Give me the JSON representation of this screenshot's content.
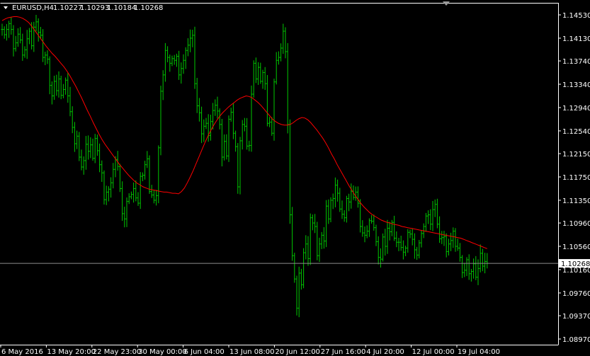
{
  "header": {
    "symbol": "EURUSD,H4",
    "open": "1.10227",
    "high": "1.10293",
    "low": "1.10184",
    "close": "1.10268"
  },
  "colors": {
    "background": "#000000",
    "axis": "#ffffff",
    "bars": "#00c800",
    "moving_average": "#ff0000",
    "price_line": "#8c8c8c",
    "price_tag_bg": "#ffffff",
    "price_tag_text": "#000000"
  },
  "chart_data": {
    "type": "line",
    "chart_style": "ohlc-bars",
    "title": "EURUSD,H4  1.10227 1.10293 1.10184 1.10268",
    "xlabel": "",
    "ylabel": "",
    "ylim": [
      1.0897,
      1.1473
    ],
    "grid": false,
    "y_ticks": [
      "1.14530",
      "1.14130",
      "1.13740",
      "1.13340",
      "1.12940",
      "1.12540",
      "1.12150",
      "1.11750",
      "1.11350",
      "1.10960",
      "1.10560",
      "1.10160",
      "1.09760",
      "1.09370",
      "1.08970"
    ],
    "x_ticks": [
      "6 May 2016",
      "13 May 20:00",
      "22 May 23:00",
      "30 May 00:00",
      "6 Jun 04:00",
      "13 Jun 08:00",
      "20 Jun 12:00",
      "27 Jun 16:00",
      "4 Jul 20:00",
      "12 Jul 00:00",
      "19 Jul 04:00"
    ],
    "current_price": "1.10268",
    "bars_close": [
      1.1428,
      1.1419,
      1.1428,
      1.1438,
      1.1428,
      1.1395,
      1.1405,
      1.142,
      1.141,
      1.1384,
      1.1393,
      1.1412,
      1.1425,
      1.14,
      1.1432,
      1.1441,
      1.1423,
      1.1418,
      1.138,
      1.1384,
      1.1377,
      1.1332,
      1.1314,
      1.1339,
      1.1323,
      1.1343,
      1.1315,
      1.1325,
      1.1341,
      1.1314,
      1.1287,
      1.126,
      1.1232,
      1.1245,
      1.1209,
      1.1192,
      1.1203,
      1.1231,
      1.1219,
      1.123,
      1.1207,
      1.1241,
      1.122,
      1.1196,
      1.1182,
      1.1136,
      1.1149,
      1.1154,
      1.1165,
      1.1188,
      1.1205,
      1.1193,
      1.1155,
      1.1112,
      1.1103,
      1.1133,
      1.1141,
      1.1145,
      1.1155,
      1.1139,
      1.113,
      1.1176,
      1.1178,
      1.1196,
      1.1206,
      1.115,
      1.1144,
      1.1135,
      1.1143,
      1.1225,
      1.1322,
      1.135,
      1.1392,
      1.138,
      1.137,
      1.1378,
      1.1375,
      1.1382,
      1.135,
      1.1361,
      1.1375,
      1.1392,
      1.1401,
      1.1413,
      1.1418,
      1.1335,
      1.1297,
      1.1285,
      1.1249,
      1.1262,
      1.1267,
      1.1246,
      1.127,
      1.1289,
      1.1298,
      1.1288,
      1.1265,
      1.1209,
      1.1236,
      1.1211,
      1.1274,
      1.1286,
      1.125,
      1.1227,
      1.1158,
      1.1237,
      1.1265,
      1.1262,
      1.1228,
      1.1229,
      1.1317,
      1.137,
      1.1343,
      1.1363,
      1.1339,
      1.1354,
      1.1335,
      1.1267,
      1.1269,
      1.125,
      1.1338,
      1.1375,
      1.138,
      1.1396,
      1.1425,
      1.139,
      1.1265,
      1.111,
      1.104,
      1.1,
      1.095,
      1.101,
      1.099,
      1.1045,
      1.106,
      1.1035,
      1.1105,
      1.1096,
      1.109,
      1.104,
      1.106,
      1.1075,
      1.1065,
      1.1125,
      1.1103,
      1.1135,
      1.1138,
      1.1161,
      1.1147,
      1.112,
      1.1111,
      1.1105,
      1.1138,
      1.1132,
      1.115,
      1.114,
      1.1149,
      1.113,
      1.109,
      1.1079,
      1.1075,
      1.1082,
      1.11,
      1.1099,
      1.1088,
      1.1064,
      1.1037,
      1.1034,
      1.1072,
      1.1056,
      1.1087,
      1.1081,
      1.1097,
      1.107,
      1.1063,
      1.1063,
      1.1054,
      1.1046,
      1.1053,
      1.108,
      1.1077,
      1.1068,
      1.105,
      1.1041,
      1.1062,
      1.1078,
      1.109,
      1.1108,
      1.111,
      1.1094,
      1.1119,
      1.1128,
      1.1094,
      1.1069,
      1.1071,
      1.1073,
      1.1047,
      1.106,
      1.1066,
      1.1082,
      1.1056,
      1.1053,
      1.1037,
      1.1011,
      1.1015,
      1.1033,
      1.1009,
      1.1013,
      1.1026,
      1.1003,
      1.1018,
      1.1044,
      1.1022,
      1.103,
      1.1027
    ],
    "moving_average": [
      1.1443,
      1.1446,
      1.1448,
      1.1449,
      1.145,
      1.145,
      1.1449,
      1.1447,
      1.1444,
      1.144,
      1.1434,
      1.1427,
      1.142,
      1.1413,
      1.1406,
      1.1399,
      1.1393,
      1.1387,
      1.1382,
      1.1376,
      1.137,
      1.1364,
      1.1357,
      1.1349,
      1.134,
      1.1331,
      1.1321,
      1.1311,
      1.13,
      1.1289,
      1.1279,
      1.1268,
      1.1258,
      1.1248,
      1.1239,
      1.1231,
      1.1224,
      1.1217,
      1.121,
      1.1203,
      1.1196,
      1.119,
      1.1184,
      1.1178,
      1.1173,
      1.1168,
      1.1164,
      1.1161,
      1.1158,
      1.1156,
      1.1154,
      1.1153,
      1.1152,
      1.1151,
      1.115,
      1.1149,
      1.1149,
      1.1148,
      1.1147,
      1.1147,
      1.1146,
      1.115,
      1.1156,
      1.1165,
      1.1175,
      1.1186,
      1.1198,
      1.121,
      1.1222,
      1.1234,
      1.1245,
      1.1255,
      1.1264,
      1.1272,
      1.1279,
      1.1285,
      1.129,
      1.1295,
      1.1299,
      1.1303,
      1.1307,
      1.131,
      1.1312,
      1.1314,
      1.1313,
      1.1311,
      1.1307,
      1.1303,
      1.1298,
      1.1292,
      1.1286,
      1.128,
      1.1274,
      1.127,
      1.1267,
      1.1265,
      1.1264,
      1.1264,
      1.1265,
      1.1268,
      1.1272,
      1.1275,
      1.1277,
      1.1276,
      1.1273,
      1.1268,
      1.1262,
      1.1256,
      1.1249,
      1.1242,
      1.1234,
      1.1225,
      1.1215,
      1.1206,
      1.1196,
      1.1187,
      1.1178,
      1.1169,
      1.116,
      1.1152,
      1.1144,
      1.1137,
      1.113,
      1.1124,
      1.1119,
      1.1114,
      1.111,
      1.1107,
      1.1104,
      1.1101,
      1.1099,
      1.1097,
      1.1096,
      1.1094,
      1.1093,
      1.1092,
      1.109,
      1.1089,
      1.1088,
      1.1087,
      1.1086,
      1.1085,
      1.1084,
      1.1083,
      1.1082,
      1.1081,
      1.108,
      1.1079,
      1.1078,
      1.1077,
      1.1076,
      1.1075,
      1.1074,
      1.1073,
      1.1072,
      1.1071,
      1.107,
      1.1068,
      1.1066,
      1.1064,
      1.1062,
      1.106,
      1.1058,
      1.1056,
      1.1054,
      1.1052
    ]
  }
}
